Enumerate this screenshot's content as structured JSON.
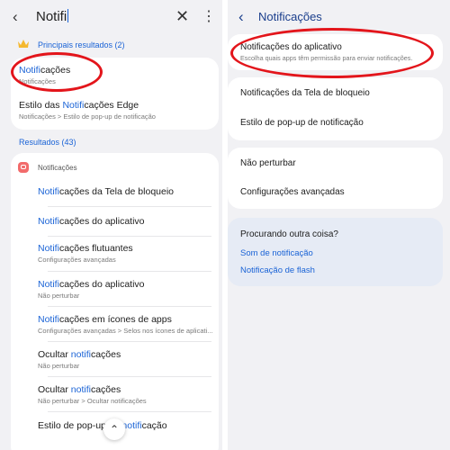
{
  "left": {
    "search": {
      "query": "Notifi"
    },
    "top_results": {
      "heading": "Principais resultados (2)",
      "items": [
        {
          "title_pre": "",
          "title_hl": "Notifi",
          "title_post": "cações",
          "subtitle": "Notificações"
        },
        {
          "title_pre": "Estilo das ",
          "title_hl": "Notifi",
          "title_post": "cações Edge",
          "subtitle": "Notificações > Estilo de pop-up de notificação"
        }
      ]
    },
    "results": {
      "heading": "Resultados (43)",
      "app_label": "Notificações",
      "items": [
        {
          "title_pre": "",
          "title_hl": "Notifi",
          "title_post": "cações da Tela de bloqueio",
          "subtitle": ""
        },
        {
          "title_pre": "",
          "title_hl": "Notifi",
          "title_post": "cações do aplicativo",
          "subtitle": ""
        },
        {
          "title_pre": "",
          "title_hl": "Notifi",
          "title_post": "cações flutuantes",
          "subtitle": "Configurações avançadas"
        },
        {
          "title_pre": "",
          "title_hl": "Notifi",
          "title_post": "cações do aplicativo",
          "subtitle": "Não perturbar"
        },
        {
          "title_pre": "",
          "title_hl": "Notifi",
          "title_post": "cações em ícones de apps",
          "subtitle": "Configurações avançadas > Selos nos ícones de aplicati..."
        },
        {
          "title_pre": "Ocultar ",
          "title_hl": "notifi",
          "title_post": "cações",
          "subtitle": "Não perturbar"
        },
        {
          "title_pre": "Ocultar ",
          "title_hl": "notifi",
          "title_post": "cações",
          "subtitle": "Não perturbar > Ocultar notificações"
        },
        {
          "title_pre": "Estilo de pop-up de ",
          "title_hl": "notifi",
          "title_post": "cação",
          "subtitle": ""
        }
      ]
    }
  },
  "right": {
    "title": "Notificações",
    "group1": [
      {
        "title": "Notificações do aplicativo",
        "subtitle": "Escolha quais apps têm permissão para enviar notificações."
      }
    ],
    "group2": [
      {
        "title": "Notificações da Tela de bloqueio"
      },
      {
        "title": "Estilo de pop-up de notificação"
      }
    ],
    "group3": [
      {
        "title": "Não perturbar"
      },
      {
        "title": "Configurações avançadas"
      }
    ],
    "suggestions": {
      "heading": "Procurando outra coisa?",
      "links": [
        "Som de notificação",
        "Notificação de flash"
      ]
    }
  },
  "colors": {
    "accent": "#1a63d6",
    "annotation": "#e3151b",
    "background": "#f1f1f4"
  }
}
